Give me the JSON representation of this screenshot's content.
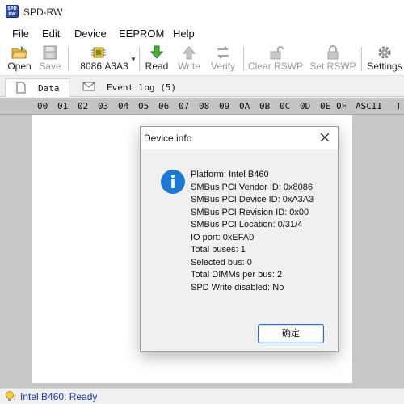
{
  "window": {
    "title": "SPD-RW",
    "icon_text": "SPD RW"
  },
  "menu": {
    "items": [
      "File",
      "Edit",
      "Device",
      "EEPROM",
      "Help"
    ]
  },
  "toolbar": {
    "open_label": "Open",
    "save_label": "Save",
    "device_combo": "8086:A3A3",
    "read_label": "Read",
    "write_label": "Write",
    "verify_label": "Verify",
    "clear_rswp_label": "Clear RSWP",
    "set_rswp_label": "Set RSWP",
    "settings_label": "Settings"
  },
  "tabs": [
    {
      "label": "Data",
      "icon": "page-icon",
      "active": true
    },
    {
      "label": "Event log (5)",
      "icon": "envelope-icon",
      "active": false
    }
  ],
  "hex_header": [
    "00",
    "01",
    "02",
    "03",
    "04",
    "05",
    "06",
    "07",
    "08",
    "09",
    "0A",
    "0B",
    "0C",
    "0D",
    "0E",
    "0F",
    "ASCII",
    "T"
  ],
  "dialog": {
    "title": "Device info",
    "lines": [
      "Platform: Intel B460",
      "SMBus PCI Vendor ID: 0x8086",
      "SMBus PCI Device ID: 0xA3A3",
      "SMBus PCI Revision ID: 0x00",
      "SMBus PCI Location: 0/31/4",
      "IO port: 0xEFA0",
      "Total buses: 1",
      "Selected bus: 0",
      "Total DIMMs per bus: 2",
      "SPD Write disabled: No"
    ],
    "ok_label": "确定"
  },
  "status": {
    "text": "Intel B460: Ready"
  },
  "colors": {
    "accent": "#2d6fc8",
    "status_text": "#1a3f9e",
    "info_icon": "#1e78d2"
  }
}
